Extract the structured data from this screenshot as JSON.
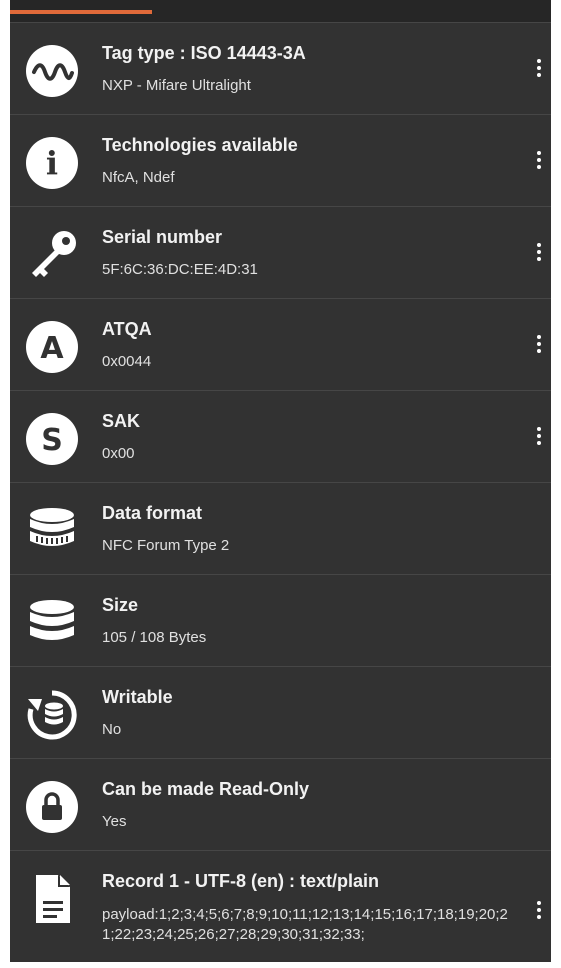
{
  "rows": [
    {
      "title": "Tag type : ISO 14443-3A",
      "sub": "NXP - Mifare Ultralight",
      "icon": "wave-signal-icon",
      "menu": true
    },
    {
      "title": "Technologies available",
      "sub": "NfcA, Ndef",
      "icon": "info-icon",
      "menu": true
    },
    {
      "title": "Serial number",
      "sub": "5F:6C:36:DC:EE:4D:31",
      "icon": "key-icon",
      "menu": true
    },
    {
      "title": "ATQA",
      "sub": "0x0044",
      "icon": "letter-a-icon",
      "menu": true
    },
    {
      "title": "SAK",
      "sub": "0x00",
      "icon": "letter-s-icon",
      "menu": true
    },
    {
      "title": "Data format",
      "sub": "NFC Forum Type 2",
      "icon": "database-format-icon",
      "menu": false
    },
    {
      "title": "Size",
      "sub": "105 / 108 Bytes",
      "icon": "database-icon",
      "menu": false
    },
    {
      "title": "Writable",
      "sub": "No",
      "icon": "database-refresh-icon",
      "menu": false
    },
    {
      "title": "Can be made Read-Only",
      "sub": "Yes",
      "icon": "lock-icon",
      "menu": false
    },
    {
      "title": "Record 1 - UTF-8 (en) : text/plain",
      "sub": "payload:1;2;3;4;5;6;7;8;9;10;11;12;13;14;15;16;17;18;19;20;21;22;23;24;25;26;27;28;29;30;31;32;33;",
      "icon": "document-icon",
      "menu": true
    }
  ],
  "icon_glyphs": {
    "letter_a": "A",
    "letter_s": "S",
    "info": "i"
  },
  "progress_fraction": 0.26,
  "colors": {
    "background": "#323232",
    "accent": "#e06a3a",
    "text": "#f2f2f2",
    "divider": "#464646"
  }
}
